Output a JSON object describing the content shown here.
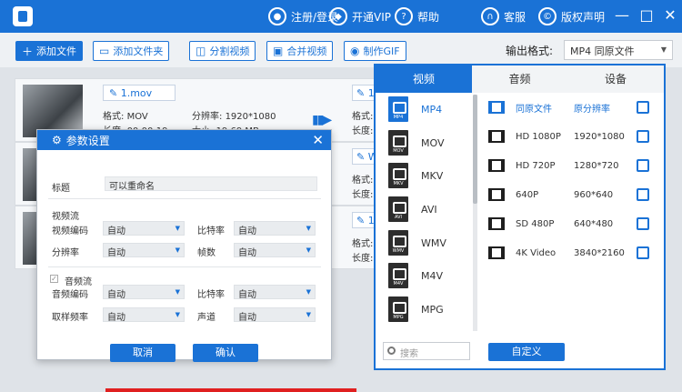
{
  "titlebar": {
    "items": [
      {
        "label": "注册/登录",
        "icon": "user-icon"
      },
      {
        "label": "开通VIP",
        "icon": "vip-icon"
      },
      {
        "label": "帮助",
        "icon": "help-icon"
      },
      {
        "label": "客服",
        "icon": "headset-icon"
      },
      {
        "label": "版权声明",
        "icon": "copyright-icon"
      }
    ],
    "window_controls": [
      "—",
      "□",
      "✕"
    ]
  },
  "toolbar": {
    "add_file": "添加文件",
    "add_folder": "添加文件夹",
    "split_video": "分割视频",
    "merge_video": "合并视频",
    "make_gif": "制作GIF",
    "output_format_label": "输出格式:",
    "output_format_value": "MP4  同原文件"
  },
  "files": [
    {
      "name": "1.mov",
      "format_label": "格式:",
      "format": "MOV",
      "resolution_label": "分辨率:",
      "resolution": "1920*1080",
      "duration_label": "长度:",
      "duration": "00:00:19",
      "size_label": "大小:",
      "size": "19.69 MB",
      "right_name": "1",
      "right_format_label": "格式:",
      "right_duration_label": "长度:"
    },
    {
      "name": "",
      "right_name": "W",
      "right_format_label": "格式:",
      "right_duration_label": "长度:"
    },
    {
      "name": "",
      "right_name": "1",
      "right_format_label": "格式:",
      "right_duration_label": "长度:"
    }
  ],
  "dialog": {
    "title": "参数设置",
    "title_label": "标题",
    "title_value": "可以重命名",
    "video_section": "视频流",
    "video_codec_label": "视频编码",
    "video_codec": "自动",
    "bitrate_label": "比特率",
    "bitrate": "自动",
    "resolution_label": "分辨率",
    "resolution": "自动",
    "fps_label": "帧数",
    "fps": "自动",
    "audio_section": "音频流",
    "audio_codec_label": "音频编码",
    "audio_codec": "自动",
    "audio_bitrate_label": "比特率",
    "audio_bitrate": "自动",
    "sample_rate_label": "取样频率",
    "sample_rate": "自动",
    "channel_label": "声道",
    "channel": "自动",
    "cancel": "取消",
    "confirm": "确认"
  },
  "panel": {
    "tabs": [
      "视频",
      "音频",
      "设备"
    ],
    "active_tab": "视频",
    "formats": [
      "MP4",
      "MOV",
      "MKV",
      "AVI",
      "WMV",
      "M4V",
      "MPG"
    ],
    "active_format": "MP4",
    "presets": [
      {
        "name": "同原文件",
        "res": "原分辨率"
      },
      {
        "name": "HD 1080P",
        "res": "1920*1080"
      },
      {
        "name": "HD 720P",
        "res": "1280*720"
      },
      {
        "name": "640P",
        "res": "960*640"
      },
      {
        "name": "SD 480P",
        "res": "640*480"
      },
      {
        "name": "4K Video",
        "res": "3840*2160"
      }
    ],
    "search_placeholder": "搜索",
    "custom_button": "自定义"
  },
  "colors": {
    "accent": "#1a72d6",
    "titlebar": "#1a72d6"
  }
}
